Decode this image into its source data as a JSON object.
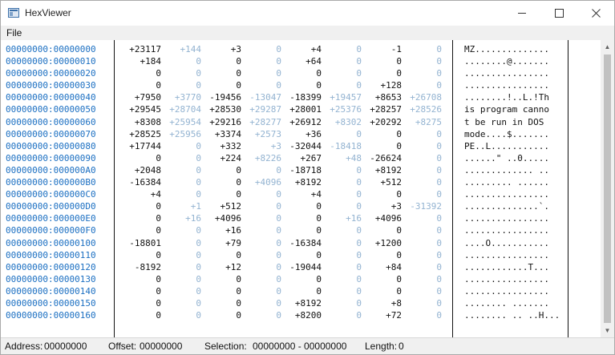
{
  "window": {
    "title": "HexViewer"
  },
  "menu": {
    "file": "File"
  },
  "rows": [
    {
      "addr": "00000000:00000000",
      "v": [
        "+23117",
        "+144",
        "+3",
        "0",
        "+4",
        "0",
        "-1",
        "0"
      ],
      "ascii": "MZ.............."
    },
    {
      "addr": "00000000:00000010",
      "v": [
        "+184",
        "0",
        "0",
        "0",
        "+64",
        "0",
        "0",
        "0"
      ],
      "ascii": "........@......."
    },
    {
      "addr": "00000000:00000020",
      "v": [
        "0",
        "0",
        "0",
        "0",
        "0",
        "0",
        "0",
        "0"
      ],
      "ascii": "................"
    },
    {
      "addr": "00000000:00000030",
      "v": [
        "0",
        "0",
        "0",
        "0",
        "0",
        "0",
        "+128",
        "0"
      ],
      "ascii": "................"
    },
    {
      "addr": "00000000:00000040",
      "v": [
        "+7950",
        "+3770",
        "-19456",
        "-13047",
        "-18399",
        "+19457",
        "+8653",
        "+26708"
      ],
      "ascii": "........!..L.!Th"
    },
    {
      "addr": "00000000:00000050",
      "v": [
        "+29545",
        "+28704",
        "+28530",
        "+29287",
        "+28001",
        "+25376",
        "+28257",
        "+28526"
      ],
      "ascii": "is program canno"
    },
    {
      "addr": "00000000:00000060",
      "v": [
        "+8308",
        "+25954",
        "+29216",
        "+28277",
        "+26912",
        "+8302",
        "+20292",
        "+8275"
      ],
      "ascii": "t be run in DOS "
    },
    {
      "addr": "00000000:00000070",
      "v": [
        "+28525",
        "+25956",
        "+3374",
        "+2573",
        "+36",
        "0",
        "0",
        "0"
      ],
      "ascii": "mode....$......."
    },
    {
      "addr": "00000000:00000080",
      "v": [
        "+17744",
        "0",
        "+332",
        "+3",
        "-32044",
        "-18418",
        "0",
        "0"
      ],
      "ascii": "PE..L..........."
    },
    {
      "addr": "00000000:00000090",
      "v": [
        "0",
        "0",
        "+224",
        "+8226",
        "+267",
        "+48",
        "-26624",
        "0"
      ],
      "ascii": "......\" ..0....."
    },
    {
      "addr": "00000000:000000A0",
      "v": [
        "+2048",
        "0",
        "0",
        "0",
        "-18718",
        "0",
        "+8192",
        "0"
      ],
      "ascii": "............. .."
    },
    {
      "addr": "00000000:000000B0",
      "v": [
        "-16384",
        "0",
        "0",
        "+4096",
        "+8192",
        "0",
        "+512",
        "0"
      ],
      "ascii": "......... ......"
    },
    {
      "addr": "00000000:000000C0",
      "v": [
        "+4",
        "0",
        "0",
        "0",
        "+4",
        "0",
        "0",
        "0"
      ],
      "ascii": "................"
    },
    {
      "addr": "00000000:000000D0",
      "v": [
        "0",
        "+1",
        "+512",
        "0",
        "0",
        "0",
        "+3",
        "-31392"
      ],
      "ascii": "..............`."
    },
    {
      "addr": "00000000:000000E0",
      "v": [
        "0",
        "+16",
        "+4096",
        "0",
        "0",
        "+16",
        "+4096",
        "0"
      ],
      "ascii": "................"
    },
    {
      "addr": "00000000:000000F0",
      "v": [
        "0",
        "0",
        "+16",
        "0",
        "0",
        "0",
        "0",
        "0"
      ],
      "ascii": "................"
    },
    {
      "addr": "00000000:00000100",
      "v": [
        "-18801",
        "0",
        "+79",
        "0",
        "-16384",
        "0",
        "+1200",
        "0"
      ],
      "ascii": "....O..........."
    },
    {
      "addr": "00000000:00000110",
      "v": [
        "0",
        "0",
        "0",
        "0",
        "0",
        "0",
        "0",
        "0"
      ],
      "ascii": "................"
    },
    {
      "addr": "00000000:00000120",
      "v": [
        "-8192",
        "0",
        "+12",
        "0",
        "-19044",
        "0",
        "+84",
        "0"
      ],
      "ascii": "............T..."
    },
    {
      "addr": "00000000:00000130",
      "v": [
        "0",
        "0",
        "0",
        "0",
        "0",
        "0",
        "0",
        "0"
      ],
      "ascii": "................"
    },
    {
      "addr": "00000000:00000140",
      "v": [
        "0",
        "0",
        "0",
        "0",
        "0",
        "0",
        "0",
        "0"
      ],
      "ascii": "................"
    },
    {
      "addr": "00000000:00000150",
      "v": [
        "0",
        "0",
        "0",
        "0",
        "+8192",
        "0",
        "+8",
        "0"
      ],
      "ascii": "........ ......."
    },
    {
      "addr": "00000000:00000160",
      "v": [
        "0",
        "0",
        "0",
        "0",
        "+8200",
        "0",
        "+72",
        "0"
      ],
      "ascii": "........ .. ..H..."
    }
  ],
  "status": {
    "address_label": "Address:",
    "address_value": "00000000",
    "offset_label": "Offset:",
    "offset_value": "00000000",
    "selection_label": "Selection:",
    "selection_value": "00000000 - 00000000",
    "length_label": "Length:",
    "length_value": "0"
  },
  "colors": {
    "address": "#1b6fc2",
    "value_dark": "#111111",
    "value_light": "#93b3d1"
  },
  "icons": {
    "app": "window-app-icon",
    "minimize": "minimize-icon",
    "maximize": "maximize-icon",
    "close": "close-icon",
    "scroll_up": "scroll-up-arrow-icon",
    "scroll_down": "scroll-down-arrow-icon"
  }
}
